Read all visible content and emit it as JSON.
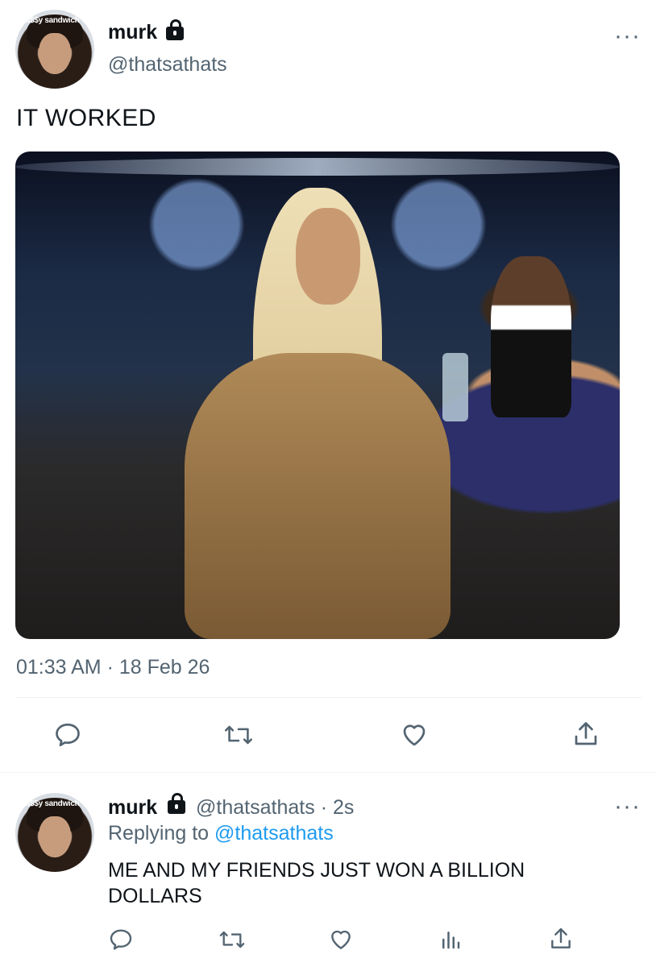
{
  "tweet": {
    "author_name": "murk",
    "author_handle": "@thatsathats",
    "avatar_text": "Pu$$y sandwich",
    "text": "IT WORKED",
    "timestamp": "01:33 AM",
    "separator": "·",
    "date": "18 Feb 26",
    "more_icon": "ellipsis-icon",
    "lock_icon": "lock-icon"
  },
  "actions": {
    "reply_icon": "reply-icon",
    "retweet_icon": "retweet-icon",
    "like_icon": "heart-icon",
    "share_icon": "share-icon"
  },
  "reply": {
    "author_name": "murk",
    "author_handle": "@thatsathats",
    "separator": "·",
    "time": "2s",
    "replying_prefix": "Replying to",
    "replying_to": "@thatsathats",
    "avatar_text": "Pu$$y sandwich",
    "text_line1": "ME AND MY FRIENDS JUST WON A BILLION",
    "text_line2": "DOLLARS",
    "actions": {
      "reply_icon": "reply-icon",
      "retweet_icon": "retweet-icon",
      "like_icon": "heart-icon",
      "stats_icon": "bar-chart-icon",
      "share_icon": "share-icon"
    }
  },
  "colors": {
    "text": "#0f1419",
    "secondary": "#536471",
    "link": "#1d9bf0",
    "divider": "#eff3f4"
  }
}
